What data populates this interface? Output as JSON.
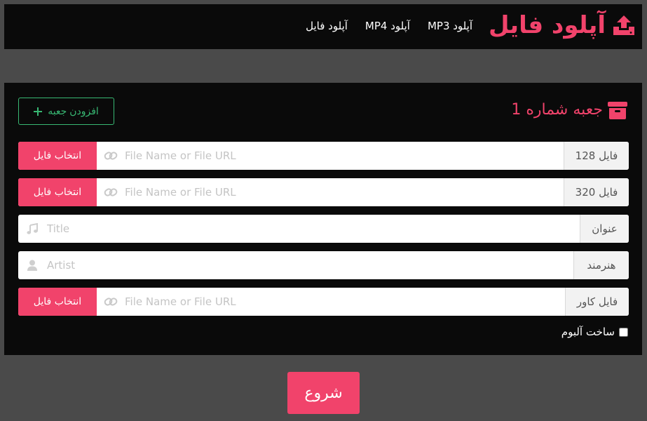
{
  "header": {
    "brand_title": "آپلود فایل",
    "brand_icon": "upload-icon",
    "nav": [
      {
        "label": "آپلود MP3"
      },
      {
        "label": "آپلود MP4"
      },
      {
        "label": "آپلود فایل"
      }
    ]
  },
  "box": {
    "title": "جعبه شماره 1",
    "title_icon": "box-icon",
    "add_button": {
      "label": "افزودن جعبه",
      "icon": "plus-icon"
    },
    "rows": [
      {
        "label": "فایل 128",
        "placeholder": "File Name or File URL",
        "button": "انتخاب فایل",
        "icon": "link-icon"
      },
      {
        "label": "فایل 320",
        "placeholder": "File Name or File URL",
        "button": "انتخاب فایل",
        "icon": "link-icon"
      },
      {
        "label": "عنوان",
        "placeholder": "Title",
        "icon": "music-icon"
      },
      {
        "label": "هنرمند",
        "placeholder": "Artist",
        "icon": "user-icon"
      },
      {
        "label": "فایل کاور",
        "placeholder": "File Name or File URL",
        "button": "انتخاب فایل",
        "icon": "link-icon"
      }
    ],
    "album_checkbox": {
      "label": "ساخت آلبوم",
      "checked": false
    }
  },
  "start_button": {
    "label": "شروع"
  },
  "colors": {
    "accent": "#f1436b",
    "success": "#38b873",
    "panel": "#0a0a0a",
    "background": "#4a4a4a"
  }
}
